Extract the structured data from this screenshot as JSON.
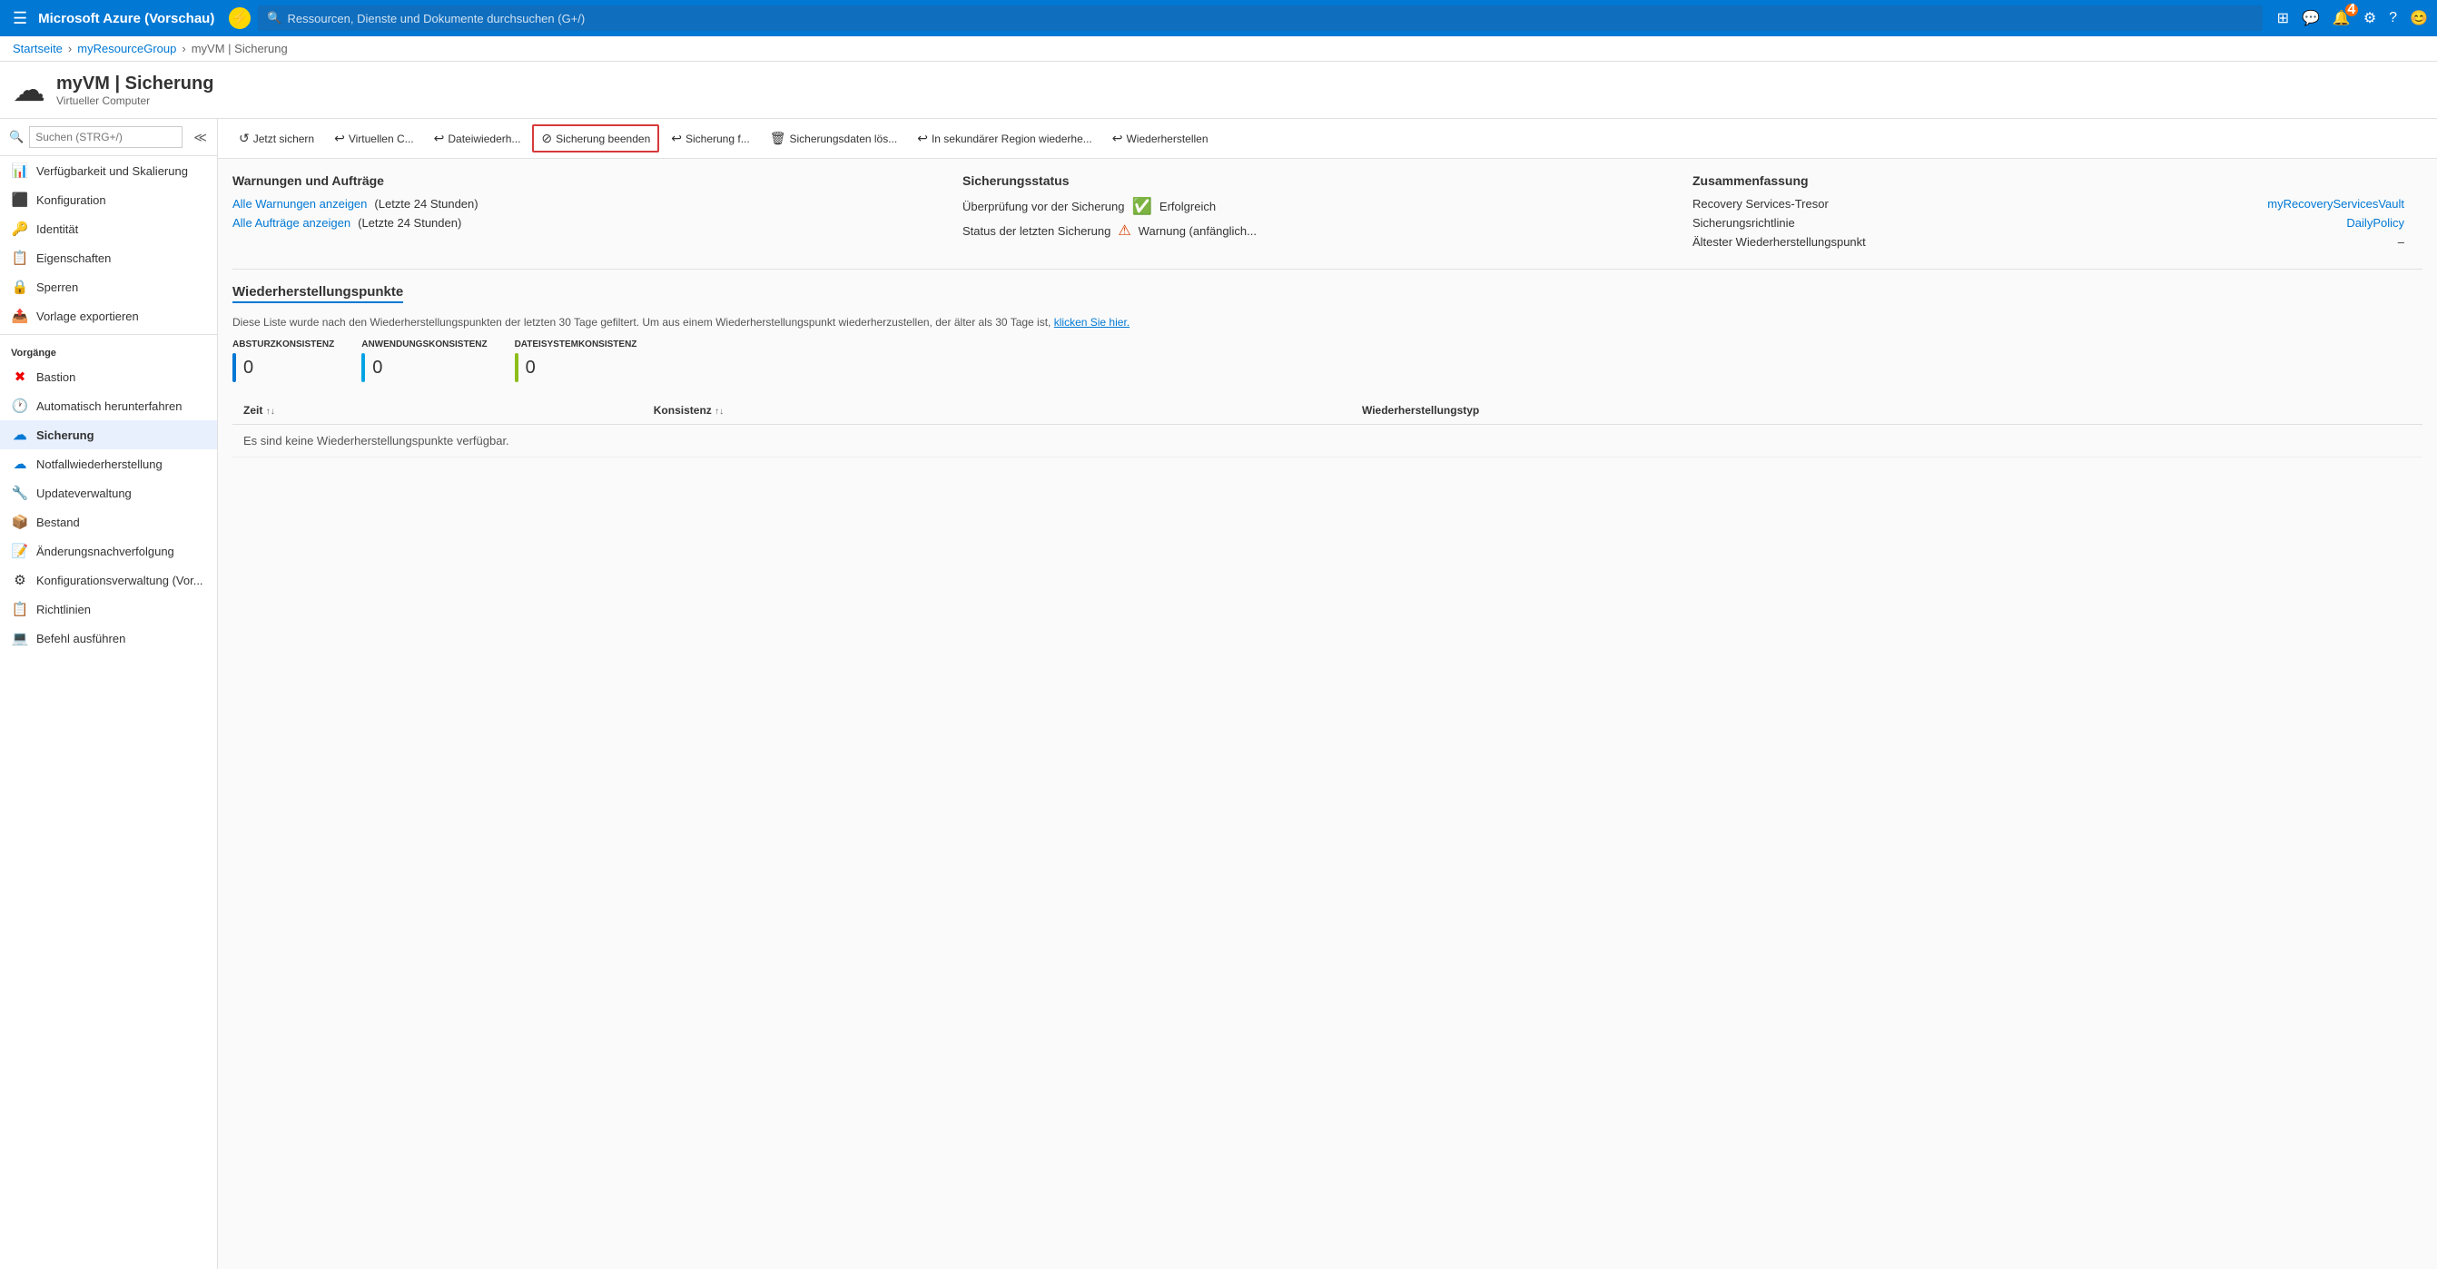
{
  "topnav": {
    "title": "Microsoft Azure (Vorschau)",
    "search_placeholder": "Ressourcen, Dienste und Dokumente durchsuchen (G+/)",
    "notification_count": "4"
  },
  "breadcrumb": {
    "home": "Startseite",
    "resource_group": "myResourceGroup",
    "current": "myVM | Sicherung"
  },
  "page_header": {
    "title": "myVM | Sicherung",
    "subtitle": "Virtueller Computer"
  },
  "sidebar_search": {
    "placeholder": "Suchen (STRG+/)"
  },
  "sidebar": {
    "items_top": [
      {
        "label": "Verfügbarkeit und Skalierung",
        "icon": "📊"
      },
      {
        "label": "Konfiguration",
        "icon": "🔴"
      },
      {
        "label": "Identität",
        "icon": "🔑"
      },
      {
        "label": "Eigenschaften",
        "icon": "📋"
      },
      {
        "label": "Sperren",
        "icon": "🔒"
      },
      {
        "label": "Vorlage exportieren",
        "icon": "📤"
      }
    ],
    "section_vorgaenge": "Vorgänge",
    "items_vorgaenge": [
      {
        "label": "Bastion",
        "icon": "✖",
        "active": false
      },
      {
        "label": "Automatisch herunterfahren",
        "icon": "🕐",
        "active": false
      },
      {
        "label": "Sicherung",
        "icon": "☁",
        "active": true
      },
      {
        "label": "Notfallwiederherstellung",
        "icon": "☁",
        "active": false
      },
      {
        "label": "Updateverwaltung",
        "icon": "🔧",
        "active": false
      },
      {
        "label": "Bestand",
        "icon": "📦",
        "active": false
      },
      {
        "label": "Änderungsnachverfolgung",
        "icon": "📝",
        "active": false
      },
      {
        "label": "Konfigurationsverwaltung (Vor...",
        "icon": "⚙",
        "active": false
      },
      {
        "label": "Richtlinien",
        "icon": "📋",
        "active": false
      },
      {
        "label": "Befehl ausführen",
        "icon": "💻",
        "active": false
      }
    ]
  },
  "toolbar": {
    "buttons": [
      {
        "label": "Jetzt sichern",
        "icon": "↺",
        "highlighted": false
      },
      {
        "label": "Virtuellen C...",
        "icon": "↩",
        "highlighted": false
      },
      {
        "label": "Dateiwiederh...",
        "icon": "↩",
        "highlighted": false
      },
      {
        "label": "Sicherung beenden",
        "icon": "⊘",
        "highlighted": true
      },
      {
        "label": "Sicherung f...",
        "icon": "↩",
        "highlighted": false
      },
      {
        "label": "Sicherungsdaten lös...",
        "icon": "🗑",
        "highlighted": false
      },
      {
        "label": "In sekundärer Region wiederhe...",
        "icon": "↩",
        "highlighted": false
      },
      {
        "label": "Wiederherstellen",
        "icon": "↩",
        "highlighted": false
      }
    ]
  },
  "warnings_section": {
    "title": "Warnungen und Aufträge",
    "link1": "Alle Warnungen anzeigen",
    "link1_suffix": "(Letzte 24 Stunden)",
    "link2": "Alle Aufträge anzeigen",
    "link2_suffix": "(Letzte 24 Stunden)"
  },
  "status_section": {
    "title": "Sicherungsstatus",
    "row1_label": "Überprüfung vor der Sicherung",
    "row1_status": "Erfolgreich",
    "row2_label": "Status der letzten Sicherung",
    "row2_status": "Warnung (anfänglich..."
  },
  "summary_section": {
    "title": "Zusammenfassung",
    "rows": [
      {
        "key": "Recovery Services-Tresor",
        "value": "myRecoveryServicesVault",
        "is_link": true
      },
      {
        "key": "Sicherungsrichtlinie",
        "value": "DailyPolicy",
        "is_link": true
      },
      {
        "key": "Ältester Wiederherstellungspunkt",
        "value": "–",
        "is_link": false
      }
    ]
  },
  "recovery_points": {
    "section_title": "Wiederherstellungspunkte",
    "info_text": "Diese Liste wurde nach den Wiederherstellungspunkten der letzten 30 Tage gefiltert. Um aus einem Wiederherstellungspunkt wiederherzustellen, der älter als 30 Tage ist,",
    "info_link": "klicken Sie hier.",
    "consistency_bars": [
      {
        "label": "ABSTURZKONSISTENZ",
        "count": "0",
        "color": "#0078d4"
      },
      {
        "label": "ANWENDUNGSKONSISTENZ",
        "count": "0",
        "color": "#00a4e4"
      },
      {
        "label": "DATEISYSTEMKONSISTENZ",
        "count": "0",
        "color": "#8cbd18"
      }
    ],
    "table_headers": [
      {
        "label": "Zeit",
        "sortable": true
      },
      {
        "label": "Konsistenz",
        "sortable": true
      },
      {
        "label": "Wiederherstellungstyp",
        "sortable": false
      }
    ],
    "empty_message": "Es sind keine Wiederherstellungspunkte verfügbar."
  }
}
